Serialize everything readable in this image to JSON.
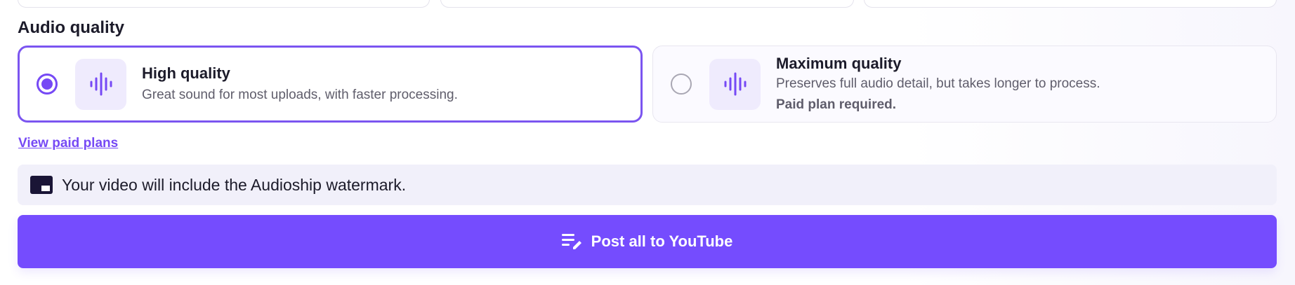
{
  "section": {
    "title": "Audio quality"
  },
  "options": [
    {
      "title": "High quality",
      "description": "Great sound for most uploads, with faster processing.",
      "selected": true
    },
    {
      "title": "Maximum quality",
      "description": "Preserves full audio detail, but takes longer to process.",
      "note": "Paid plan required.",
      "selected": false
    }
  ],
  "links": {
    "paid_plans": "View paid plans"
  },
  "notice": {
    "text": "Your video will include the Audioship watermark.",
    "icon": "watermark-icon"
  },
  "actions": {
    "post_label": "Post all to YouTube",
    "post_icon": "playlist-edit-icon"
  },
  "colors": {
    "accent": "#754cfe",
    "accent_tint": "#efebfd",
    "notice_bg": "#f1f0fa"
  }
}
